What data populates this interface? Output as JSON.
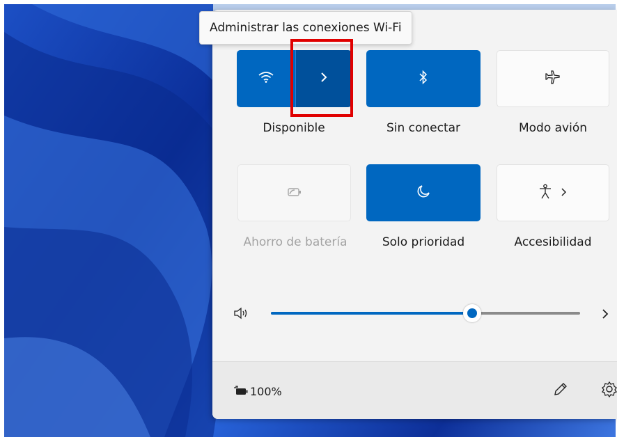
{
  "tooltip": {
    "text": "Administrar las conexiones Wi-Fi"
  },
  "tiles": {
    "wifi": {
      "label": "Disponible",
      "icon": "wifi-icon",
      "state": "on"
    },
    "bluetooth": {
      "label": "Sin conectar",
      "icon": "bluetooth-icon",
      "state": "on"
    },
    "airplane": {
      "label": "Modo avión",
      "icon": "airplane-icon",
      "state": "off"
    },
    "battery_saver": {
      "label": "Ahorro de batería",
      "icon": "battery-saver-icon",
      "state": "disabled"
    },
    "focus": {
      "label": "Solo prioridad",
      "icon": "moon-icon",
      "state": "on"
    },
    "accessibility": {
      "label": "Accesibilidad",
      "icon": "accessibility-icon",
      "state": "off"
    }
  },
  "volume": {
    "level_percent": 65,
    "icon": "speaker-icon"
  },
  "footer": {
    "battery_text": "100%",
    "battery_icon": "battery-charging-icon",
    "edit_icon": "pencil-icon",
    "settings_icon": "gear-icon"
  },
  "colors": {
    "accent": "#0067c0",
    "accent_dark": "#00509b",
    "highlight": "#e00000",
    "panel": "#f3f3f3"
  }
}
